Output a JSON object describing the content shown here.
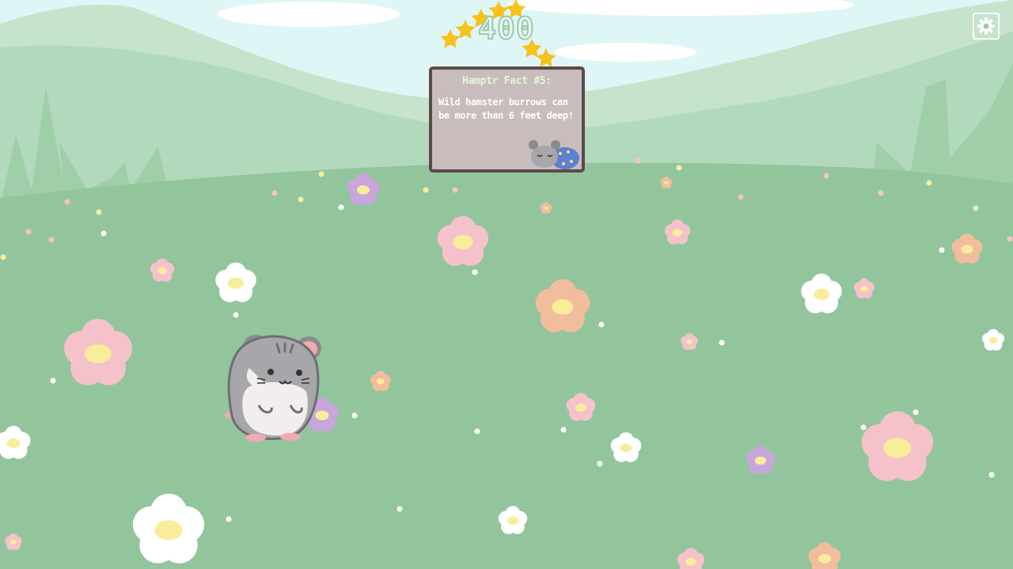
{
  "hud": {
    "score": "400",
    "settings_icon": "gear-icon"
  },
  "fact_card": {
    "title": "Hamptr Fact #5:",
    "text": "Wild hamster burrows can be more than 6 feet deep!",
    "illustration": "sleeping-hamster-icon"
  },
  "player": {
    "character": "hamster"
  },
  "colors": {
    "sky": "#dff6f6",
    "hills_far": "#c6e3cc",
    "hills_near": "#b3d9bd",
    "meadow": "#93c59d",
    "star": "#f6c21c",
    "card_bg": "#c9bcbc",
    "card_border": "#5a4a4a",
    "flower_pink": "#f5c2cc",
    "flower_white": "#ffffff",
    "flower_purple": "#c8a6dc",
    "flower_orange": "#f2bd9c",
    "flower_center": "#f8ee9a"
  }
}
